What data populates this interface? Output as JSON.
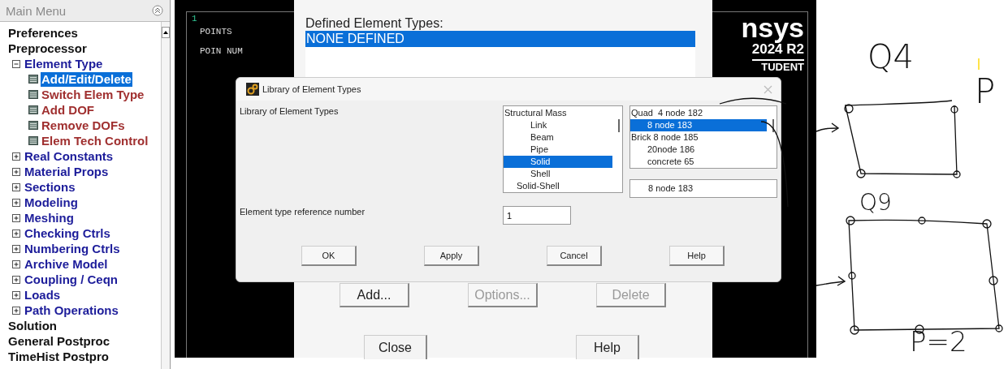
{
  "main_menu": {
    "title": "Main Menu",
    "items": [
      {
        "label": "Preferences",
        "kind": "top"
      },
      {
        "label": "Preprocessor",
        "kind": "top",
        "children": [
          {
            "label": "Element Type",
            "kind": "branch",
            "expanded": true,
            "children": [
              {
                "label": "Add/Edit/Delete",
                "kind": "leaf",
                "selected": true
              },
              {
                "label": "Switch Elem Type",
                "kind": "leaf",
                "selected": false
              },
              {
                "label": "Add DOF",
                "kind": "leaf",
                "selected": false
              },
              {
                "label": "Remove DOFs",
                "kind": "leaf",
                "selected": false
              },
              {
                "label": "Elem Tech Control",
                "kind": "leaf",
                "selected": false
              }
            ]
          },
          {
            "label": "Real Constants",
            "kind": "branch",
            "expanded": false
          },
          {
            "label": "Material Props",
            "kind": "branch",
            "expanded": false
          },
          {
            "label": "Sections",
            "kind": "branch",
            "expanded": false
          },
          {
            "label": "Modeling",
            "kind": "branch",
            "expanded": false
          },
          {
            "label": "Meshing",
            "kind": "branch",
            "expanded": false
          },
          {
            "label": "Checking Ctrls",
            "kind": "branch",
            "expanded": false
          },
          {
            "label": "Numbering Ctrls",
            "kind": "branch",
            "expanded": false
          },
          {
            "label": "Archive Model",
            "kind": "branch",
            "expanded": false
          },
          {
            "label": "Coupling / Ceqn",
            "kind": "branch",
            "expanded": false
          },
          {
            "label": "Loads",
            "kind": "branch",
            "expanded": false
          },
          {
            "label": "Path Operations",
            "kind": "branch",
            "expanded": false
          }
        ]
      },
      {
        "label": "Solution",
        "kind": "top"
      },
      {
        "label": "General Postproc",
        "kind": "top"
      },
      {
        "label": "TimeHist Postpro",
        "kind": "top"
      }
    ]
  },
  "graphics": {
    "window_number": "1",
    "legend": [
      "POINTS",
      "POIN NUM"
    ],
    "logo": "nsys",
    "version": "2024 R2",
    "edition": "TUDENT"
  },
  "element_types_dialog": {
    "label": "Defined Element Types:",
    "types": [
      {
        "label": "NONE DEFINED",
        "selected": true
      }
    ],
    "buttons": [
      {
        "label": "Add...",
        "disabled": false
      },
      {
        "label": "Options...",
        "disabled": true
      },
      {
        "label": "Delete",
        "disabled": true
      }
    ],
    "bottom_buttons": [
      {
        "label": "Close"
      },
      {
        "label": "Help"
      }
    ]
  },
  "library_dialog": {
    "title": "Library of Element Types",
    "label": "Library of Element Types",
    "categories": [
      {
        "label": "Structural Mass",
        "kind": "group",
        "selected": false
      },
      {
        "label": "Link",
        "kind": "item",
        "selected": false
      },
      {
        "label": "Beam",
        "kind": "item",
        "selected": false
      },
      {
        "label": "Pipe",
        "kind": "item",
        "selected": false
      },
      {
        "label": "Solid",
        "kind": "item",
        "selected": true
      },
      {
        "label": "Shell",
        "kind": "item",
        "selected": false
      },
      {
        "label": "Solid-Shell",
        "kind": "subgroup",
        "selected": false
      }
    ],
    "elements": [
      {
        "label": "Quad  4 node 182",
        "kind": "group",
        "selected": false
      },
      {
        "label": "8 node 183",
        "kind": "item",
        "selected": true
      },
      {
        "label": "Brick 8 node 185",
        "kind": "group",
        "selected": false
      },
      {
        "label": "20node 186",
        "kind": "item",
        "selected": false
      },
      {
        "label": "concrete 65",
        "kind": "item",
        "selected": false
      }
    ],
    "selection": "8 node 183",
    "ref_label": "Element type reference number",
    "ref_value": "1",
    "buttons": [
      {
        "label": "OK"
      },
      {
        "label": "Apply"
      },
      {
        "label": "Cancel"
      },
      {
        "label": "Help"
      }
    ]
  },
  "annotations": [
    {
      "text": "Q4"
    },
    {
      "text": "P"
    },
    {
      "text": "Q9"
    },
    {
      "text": "P=2"
    }
  ]
}
